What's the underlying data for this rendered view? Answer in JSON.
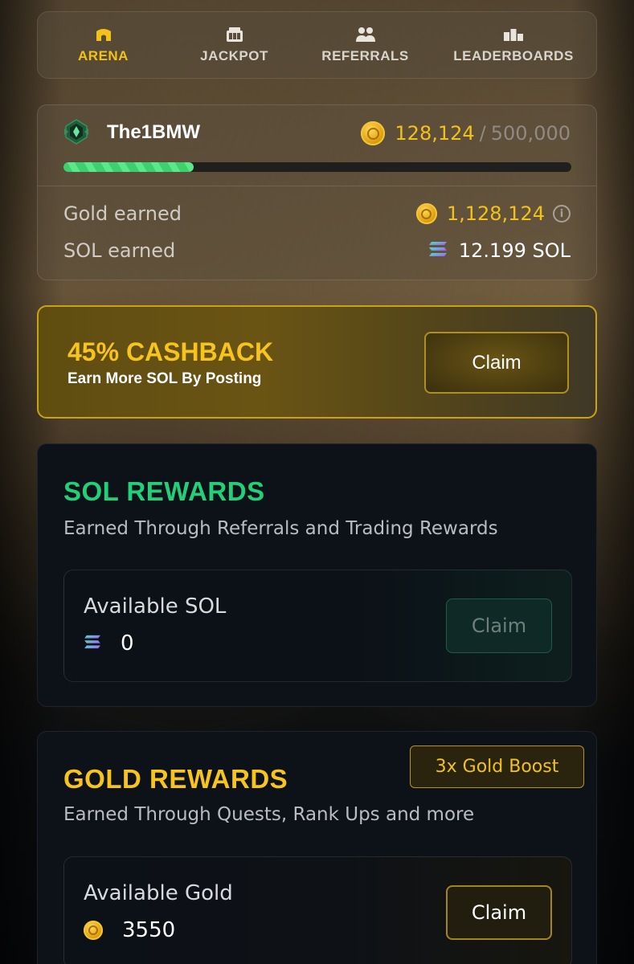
{
  "nav": {
    "tabs": [
      {
        "label": "ARENA",
        "icon": "arena-icon",
        "active": true
      },
      {
        "label": "JACKPOT",
        "icon": "jackpot-icon",
        "active": false
      },
      {
        "label": "REFERRALS",
        "icon": "referrals-icon",
        "active": false
      },
      {
        "label": "LEADERBOARDS",
        "icon": "leaderboards-icon",
        "active": false
      }
    ]
  },
  "profile": {
    "username": "The1BMW",
    "rank_icon": "rank-badge-icon",
    "xp_current": "128,124",
    "xp_separator": "/",
    "xp_max": "500,000",
    "xp_progress": 0.256,
    "gold_earned_label": "Gold earned",
    "gold_earned_value": "1,128,124",
    "sol_earned_label": "SOL earned",
    "sol_earned_value": "12.199 SOL"
  },
  "cashback": {
    "title": "45% CASHBACK",
    "subtitle": "Earn More SOL By Posting",
    "claim_label": "Claim"
  },
  "sol_rewards": {
    "title": "SOL REWARDS",
    "subtitle": "Earned Through Referrals and Trading Rewards",
    "available_label": "Available SOL",
    "available_value": "0",
    "claim_label": "Claim"
  },
  "gold_rewards": {
    "title": "GOLD REWARDS",
    "subtitle": "Earned Through Quests, Rank Ups and more",
    "boost_badge": "3x Gold Boost",
    "available_label": "Available Gold",
    "available_value": "3550",
    "claim_label": "Claim"
  },
  "colors": {
    "accent_gold": "#f2c21a",
    "accent_green": "#22d07a",
    "card_bg": "#0d1118"
  }
}
